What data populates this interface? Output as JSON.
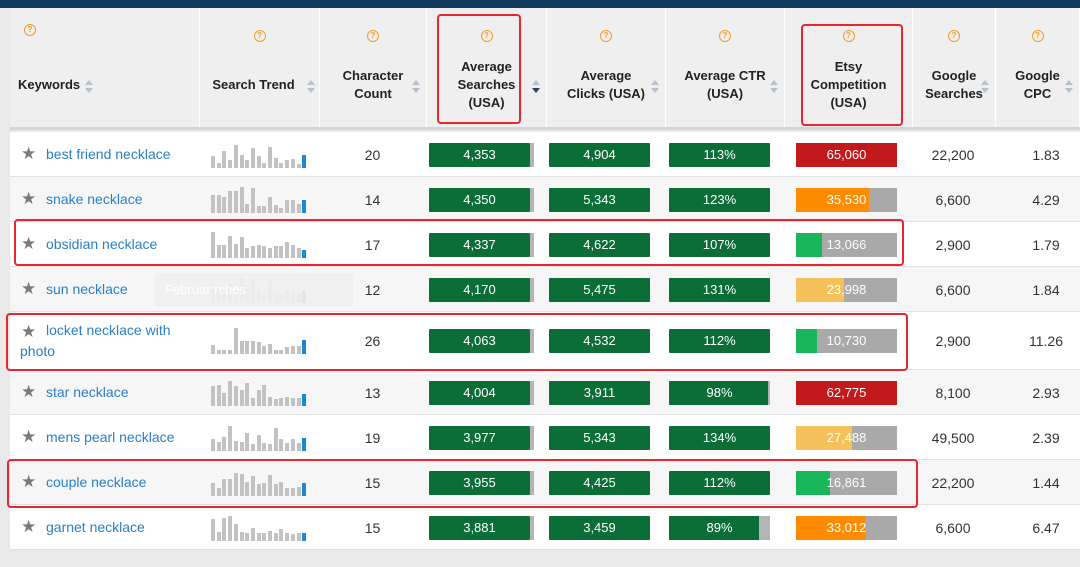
{
  "columns": [
    {
      "key": "keywords",
      "label": "Keywords"
    },
    {
      "key": "trend",
      "label": "Search Trend"
    },
    {
      "key": "chars",
      "label": "Character\nCount"
    },
    {
      "key": "avg_searches",
      "label": "Average\nSearches\n(USA)"
    },
    {
      "key": "avg_clicks",
      "label": "Average\nClicks (USA)"
    },
    {
      "key": "avg_ctr",
      "label": "Average CTR\n(USA)"
    },
    {
      "key": "etsy_comp",
      "label": "Etsy\nCompetition\n(USA)"
    },
    {
      "key": "google_searches",
      "label": "Google\nSearches"
    },
    {
      "key": "google_cpc",
      "label": "Google\nCPC"
    }
  ],
  "help_icon": "question-circle-icon",
  "colors": {
    "green": "#0b6e37",
    "red": "#c2191c",
    "orange": "#ff8c00",
    "yellow": "#f4c15a",
    "lightgreen": "#18b85a",
    "highlight": "#e6282e",
    "link": "#2a7fc8"
  },
  "rows": [
    {
      "keyword": "best friend necklace",
      "chars": "20",
      "avg_searches": "4,353",
      "avg_clicks": "4,904",
      "avg_ctr": "113%",
      "etsy_comp": "65,060",
      "comp_level": 1.0,
      "comp_color": "#c2191c",
      "google_searches": "22,200",
      "google_cpc": "1.83",
      "trend": [
        0.45,
        0.2,
        0.65,
        0.3,
        0.9,
        0.5,
        0.3,
        0.75,
        0.45,
        0.2,
        0.8,
        0.4,
        0.2,
        0.3,
        0.35,
        0.15,
        0.5
      ]
    },
    {
      "keyword": "snake necklace",
      "chars": "14",
      "avg_searches": "4,350",
      "avg_clicks": "5,343",
      "avg_ctr": "123%",
      "etsy_comp": "35,530",
      "comp_level": 0.72,
      "comp_color": "#ff8c00",
      "google_searches": "6,600",
      "google_cpc": "4.29",
      "trend": [
        0.7,
        0.7,
        0.6,
        0.85,
        0.85,
        1.0,
        0.35,
        0.95,
        0.25,
        0.25,
        0.6,
        0.3,
        0.2,
        0.5,
        0.5,
        0.35,
        0.5
      ]
    },
    {
      "keyword": "obsidian necklace",
      "chars": "17",
      "avg_searches": "4,337",
      "avg_clicks": "4,622",
      "avg_ctr": "107%",
      "etsy_comp": "13,066",
      "comp_level": 0.26,
      "comp_color": "#18b85a",
      "google_searches": "2,900",
      "google_cpc": "1.79",
      "trend": [
        1.0,
        0.5,
        0.5,
        0.85,
        0.55,
        0.8,
        0.4,
        0.45,
        0.5,
        0.45,
        0.4,
        0.45,
        0.45,
        0.6,
        0.5,
        0.4,
        0.3
      ]
    },
    {
      "keyword": "sun necklace",
      "chars": "12",
      "avg_searches": "4,170",
      "avg_clicks": "5,475",
      "avg_ctr": "131%",
      "etsy_comp": "23,998",
      "comp_level": 0.48,
      "comp_color": "#f4c15a",
      "google_searches": "6,600",
      "google_cpc": "1.84",
      "trend": [
        0.55,
        0.55,
        0.45,
        0.75,
        0.5,
        0.95,
        0.55,
        0.9,
        0.5,
        0.3,
        0.85,
        0.35,
        0.4,
        0.5,
        0.45,
        0.35,
        0.45
      ]
    },
    {
      "keyword": "locket necklace with photo",
      "chars": "26",
      "avg_searches": "4,063",
      "avg_clicks": "4,532",
      "avg_ctr": "112%",
      "etsy_comp": "10,730",
      "comp_level": 0.21,
      "comp_color": "#18b85a",
      "google_searches": "2,900",
      "google_cpc": "11.26",
      "trend": [
        0.35,
        0.15,
        0.15,
        0.15,
        1.0,
        0.5,
        0.5,
        0.5,
        0.45,
        0.3,
        0.4,
        0.15,
        0.15,
        0.25,
        0.3,
        0.3,
        0.55
      ]
    },
    {
      "keyword": "star necklace",
      "chars": "13",
      "avg_searches": "4,004",
      "avg_clicks": "3,911",
      "avg_ctr": "98%",
      "etsy_comp": "62,775",
      "comp_level": 1.0,
      "comp_color": "#c2191c",
      "google_searches": "8,100",
      "google_cpc": "2.93",
      "trend": [
        0.75,
        0.8,
        0.5,
        0.95,
        0.75,
        0.6,
        0.9,
        0.3,
        0.6,
        0.8,
        0.35,
        0.25,
        0.3,
        0.35,
        0.3,
        0.3,
        0.45
      ]
    },
    {
      "keyword": "mens pearl necklace",
      "chars": "19",
      "avg_searches": "3,977",
      "avg_clicks": "5,343",
      "avg_ctr": "134%",
      "etsy_comp": "27,488",
      "comp_level": 0.55,
      "comp_color": "#f4c15a",
      "google_searches": "49,500",
      "google_cpc": "2.39",
      "trend": [
        0.45,
        0.35,
        0.55,
        0.95,
        0.4,
        0.35,
        0.7,
        0.25,
        0.6,
        0.3,
        0.25,
        0.9,
        0.45,
        0.3,
        0.45,
        0.3,
        0.5
      ]
    },
    {
      "keyword": "couple necklace",
      "chars": "15",
      "avg_searches": "3,955",
      "avg_clicks": "4,425",
      "avg_ctr": "112%",
      "etsy_comp": "16,861",
      "comp_level": 0.34,
      "comp_color": "#18b85a",
      "google_searches": "22,200",
      "google_cpc": "1.44",
      "trend": [
        0.5,
        0.3,
        0.65,
        0.65,
        0.9,
        0.85,
        0.55,
        0.75,
        0.45,
        0.5,
        0.8,
        0.45,
        0.55,
        0.3,
        0.3,
        0.35,
        0.5
      ]
    },
    {
      "keyword": "garnet necklace",
      "chars": "15",
      "avg_searches": "3,881",
      "avg_clicks": "3,459",
      "avg_ctr": "89%",
      "etsy_comp": "33,012",
      "comp_level": 0.68,
      "comp_color": "#ff8c00",
      "google_searches": "6,600",
      "google_cpc": "6.47",
      "trend": [
        0.85,
        0.35,
        0.9,
        0.95,
        0.65,
        0.35,
        0.3,
        0.5,
        0.3,
        0.3,
        0.4,
        0.3,
        0.45,
        0.3,
        0.25,
        0.3,
        0.3
      ]
    }
  ],
  "ctr_fill": [
    1.0,
    1.0,
    1.0,
    1.0,
    1.0,
    0.98,
    1.0,
    1.0,
    0.89
  ],
  "tooltip_text": "Februar                         rches"
}
